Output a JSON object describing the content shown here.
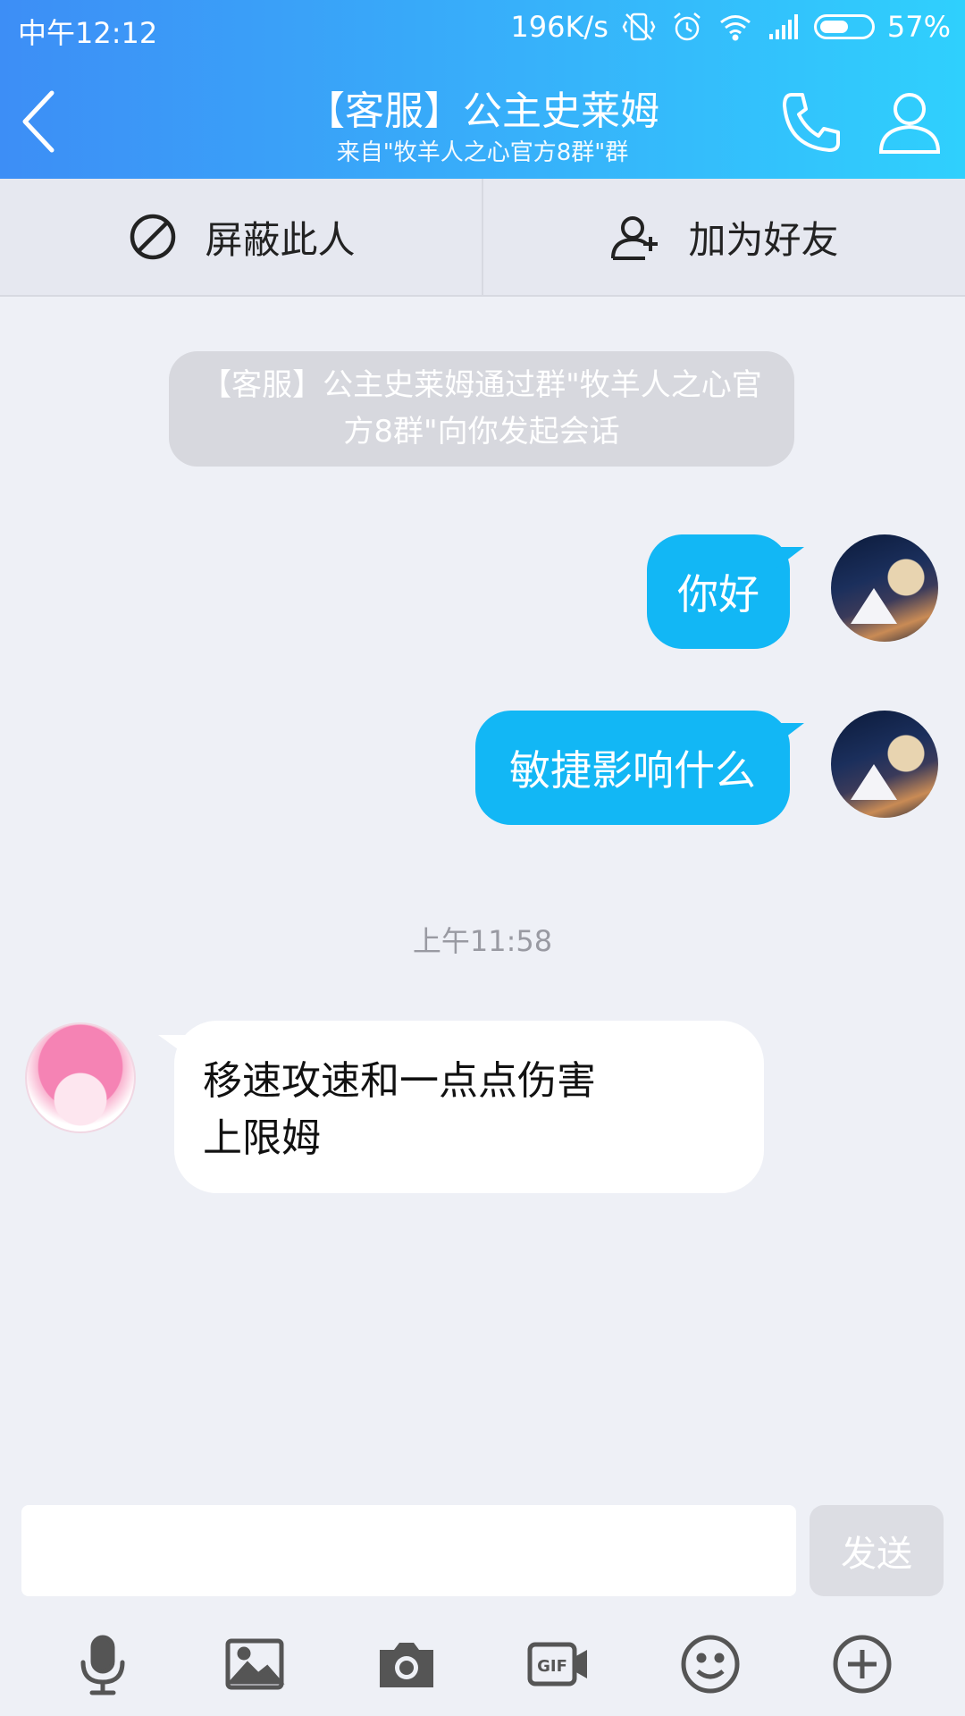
{
  "status_bar": {
    "time": "中午12:12",
    "network_speed": "196K/s",
    "battery_percent": "57%",
    "battery_level": 0.57
  },
  "nav": {
    "title": "【客服】公主史莱姆",
    "subtitle": "来自\"牧羊人之心官方8群\"群"
  },
  "actions": {
    "block_label": "屏蔽此人",
    "add_friend_label": "加为好友"
  },
  "system_notice": "【客服】公主史莱姆通过群\"牧羊人之心官方8群\"向你发起会话",
  "messages": {
    "out_1": "你好",
    "out_2": "敏捷影响什么",
    "timestamp": "上午11:58",
    "in_1_line1": "移速攻速和一点点伤害",
    "in_1_line2": "上限姆"
  },
  "input": {
    "value": "",
    "send_label": "发送"
  },
  "toolbar": [
    "microphone-icon",
    "image-icon",
    "camera-icon",
    "gif-icon",
    "emoji-icon",
    "plus-icon"
  ],
  "colors": {
    "header_start": "#3d8ef6",
    "header_end": "#2fd0fd",
    "outgoing_bubble": "#12b7f5",
    "background": "#eef0f6"
  }
}
